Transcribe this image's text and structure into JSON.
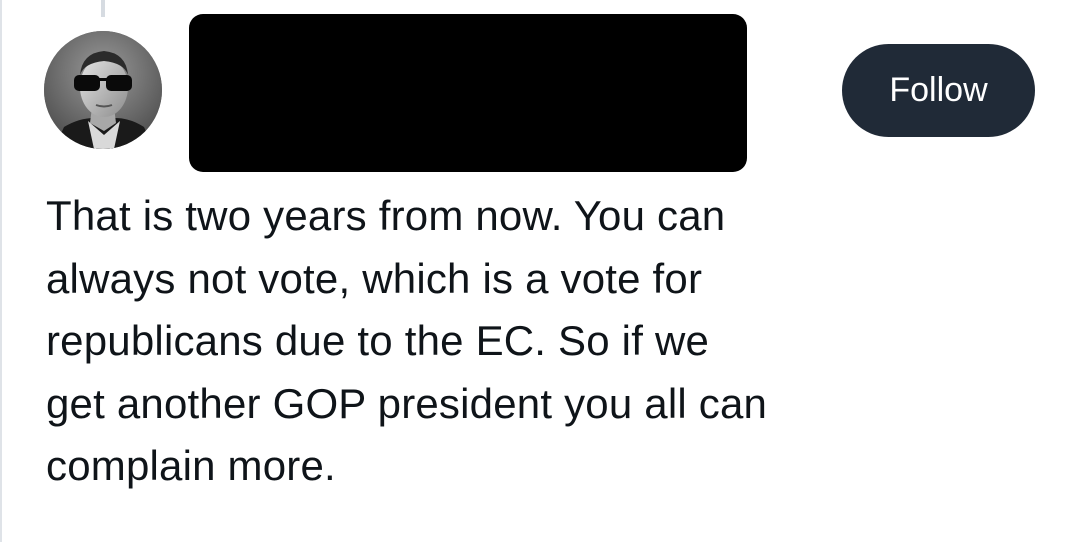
{
  "post": {
    "author": {
      "avatar_icon": "profile-photo",
      "name_redacted": true
    },
    "follow_label": "Follow",
    "text_lines": [
      "That is two years from now. You can",
      "always not vote, which is a vote for",
      "republicans due to the EC. So if we",
      "get another GOP president you all can",
      "complain more."
    ]
  },
  "colors": {
    "follow_button_bg": "#202a37",
    "follow_button_text": "#ffffff",
    "text": "#0f1419",
    "redaction": "#000000",
    "thread_line": "#d6dbe1"
  }
}
